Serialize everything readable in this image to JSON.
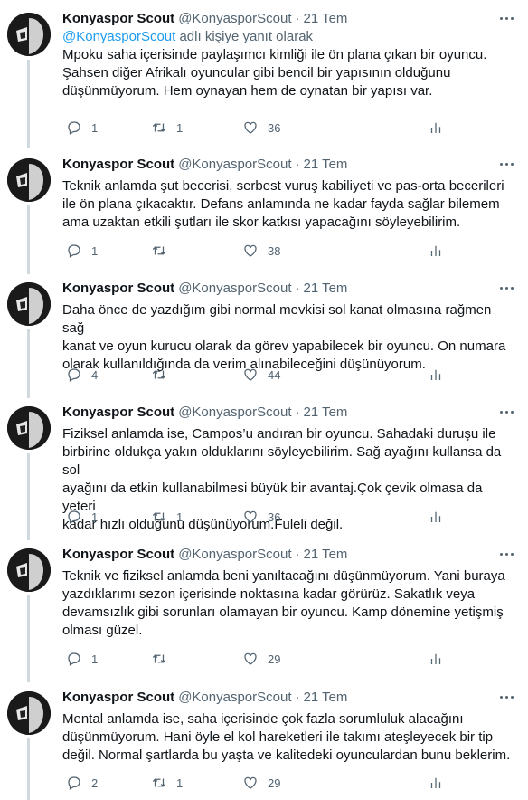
{
  "tweets": [
    {
      "name": "Konyaspor Scout",
      "handle": "@KonyasporScout",
      "time": "21 Tem",
      "reply_prefix": "@KonyasporScout",
      "reply_suffix": " adlı kişiye yanıt olarak",
      "lines": [
        "Mpoku saha içerisinde paylaşımcı kimliği ile ön plana çıkan bir oyuncu.",
        "Şahsen diğer Afrikalı oyuncular gibi bencil bir yapısının olduğunu",
        "düşünmüyorum. Hem oynayan hem de oynatan bir yapısı var."
      ],
      "replies": "1",
      "retweets": "1",
      "likes": "36"
    },
    {
      "name": "Konyaspor Scout",
      "handle": "@KonyasporScout",
      "time": "21 Tem",
      "lines": [
        "Teknik anlamda şut becerisi, serbest vuruş kabiliyeti ve pas-orta becerileri",
        "ile ön plana çıkacaktır. Defans anlamında ne kadar fayda sağlar bilemem",
        "ama uzaktan etkili şutları ile skor katkısı yapacağını söyleyebilirim."
      ],
      "replies": "1",
      "retweets": "",
      "likes": "38"
    },
    {
      "name": "Konyaspor Scout",
      "handle": "@KonyasporScout",
      "time": "21 Tem",
      "lines": [
        "Daha önce de yazdığım gibi normal mevkisi sol kanat olmasına rağmen sağ",
        "kanat ve oyun kurucu olarak da görev yapabilecek bir oyuncu. On numara",
        "olarak kullanıldığında da verim alınabileceğini düşünüyorum."
      ],
      "replies": "4",
      "retweets": "",
      "likes": "44"
    },
    {
      "name": "Konyaspor Scout",
      "handle": "@KonyasporScout",
      "time": "21 Tem",
      "lines": [
        "Fiziksel anlamda ise, Campos’u andıran bir oyuncu. Sahadaki duruşu ile",
        "birbirine oldukça yakın olduklarını söyleyebilirim. Sağ ayağını kullansa da sol",
        "ayağını da etkin kullanabilmesi büyük bir avantaj.Çok çevik olmasa da yeteri",
        "kadar hızlı olduğunu düşünüyorum.Fuleli değil."
      ],
      "replies": "1",
      "retweets": "1",
      "likes": "36"
    },
    {
      "name": "Konyaspor Scout",
      "handle": "@KonyasporScout",
      "time": "21 Tem",
      "lines": [
        "Teknik ve fiziksel anlamda beni yanıltacağını düşünmüyorum. Yani buraya",
        "yazdıklarımı sezon içerisinde noktasına kadar görürüz. Sakatlık veya",
        "devamsızlık gibi sorunları olamayan bir oyuncu. Kamp dönemine yetişmiş",
        "olması güzel."
      ],
      "replies": "1",
      "retweets": "",
      "likes": "29"
    },
    {
      "name": "Konyaspor Scout",
      "handle": "@KonyasporScout",
      "time": "21 Tem",
      "lines": [
        "Mental anlamda ise, saha içerisinde çok fazla sorumluluk alacağını",
        "düşünmüyorum. Hani öyle el kol hareketleri ile takımı ateşleyecek bir tip",
        "değil. Normal şartlarda bu yaşta ve kalitedeki oyunculardan bunu beklerim."
      ],
      "replies": "2",
      "retweets": "1",
      "likes": "29"
    }
  ],
  "colors": {
    "text": "#0f1419",
    "secondary": "#536471",
    "link": "#1d9bf0",
    "thread_line": "#cfd9de"
  },
  "icons": [
    "more-icon",
    "reply-icon",
    "retweet-icon",
    "like-icon",
    "analytics-icon"
  ]
}
